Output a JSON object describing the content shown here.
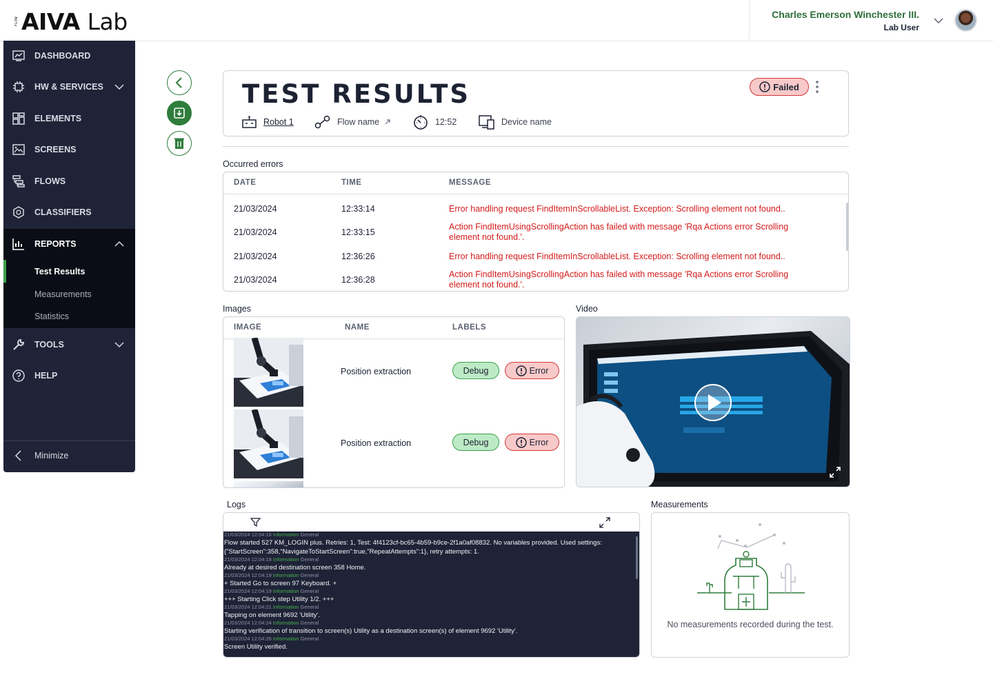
{
  "app": {
    "logo_small": "FLOW",
    "logo_main": "AIVA",
    "logo_lab": "Lab"
  },
  "user": {
    "name": "Charles Emerson Winchester III.",
    "role": "Lab User"
  },
  "sidebar": {
    "items": [
      {
        "label": "DASHBOARD",
        "icon": "dashboard-icon"
      },
      {
        "label": "HW & SERVICES",
        "icon": "chip-icon"
      },
      {
        "label": "ELEMENTS",
        "icon": "elements-icon"
      },
      {
        "label": "SCREENS",
        "icon": "screens-icon"
      },
      {
        "label": "FLOWS",
        "icon": "flows-icon"
      },
      {
        "label": "CLASSIFIERS",
        "icon": "classifiers-icon"
      },
      {
        "label": "REPORTS",
        "icon": "reports-icon"
      },
      {
        "label": "TOOLS",
        "icon": "wrench-icon"
      },
      {
        "label": "HELP",
        "icon": "help-icon"
      }
    ],
    "reports_sub": [
      "Test Results",
      "Measurements",
      "Statistics"
    ],
    "minimize": "Minimize"
  },
  "test": {
    "title": "TEST RESULTS",
    "status": "Failed",
    "robot": "Robot 1",
    "flow": "Flow name",
    "duration": "12:52",
    "device": "Device name"
  },
  "errors": {
    "label": "Occurred errors",
    "columns": [
      "DATE",
      "TIME",
      "MESSAGE"
    ],
    "rows": [
      {
        "date": "21/03/2024",
        "time": "12:33:14",
        "message": "Error handling request FindItemInScrollableList. Exception: Scrolling element not found.."
      },
      {
        "date": "21/03/2024",
        "time": "12:33:15",
        "message": "Action FindItemUsingScrollingAction has failed with message 'Rqa Actions error Scrolling element not found.'."
      },
      {
        "date": "21/03/2024",
        "time": "12:36:26",
        "message": "Error handling request FindItemInScrollableList. Exception: Scrolling element not found.."
      },
      {
        "date": "21/03/2024",
        "time": "12:36:28",
        "message": "Action FindItemUsingScrollingAction has failed with message 'Rqa Actions error Scrolling element not found.'."
      }
    ]
  },
  "images": {
    "label": "Images",
    "columns": [
      "IMAGE",
      "NAME",
      "LABELS"
    ],
    "rows": [
      {
        "name": "Position extraction",
        "tags": [
          "Debug",
          "Error"
        ]
      },
      {
        "name": "Position extraction",
        "tags": [
          "Debug",
          "Error"
        ]
      }
    ]
  },
  "video": {
    "label": "Video"
  },
  "logs": {
    "label": "Logs",
    "entries": [
      {
        "meta": "21/03/2024 12:04:16",
        "level": "Information",
        "category": "General",
        "text": "Flow started 527 KM_LOGIN plus. Retries: 1, Test: 4f4123cf-bc65-4b59-b9ce-2f1a0af08832. No variables provided. Used settings: {\"StartScreen\":358,\"NavigateToStartScreen\":true,\"RepeatAttempts\":1}, retry attempts: 1."
      },
      {
        "meta": "21/03/2024 12:04:18",
        "level": "Information",
        "category": "General",
        "text": "Already at desired destination screen 358 Home."
      },
      {
        "meta": "21/03/2024 12:04:19",
        "level": "Information",
        "category": "General",
        "text": "+ Started Go to screen 97 Keyboard. +"
      },
      {
        "meta": "21/03/2024 12:04:19",
        "level": "Information",
        "category": "General",
        "text": "+++ Starting Click step Utility 1/2. +++"
      },
      {
        "meta": "21/03/2024 12:04:21",
        "level": "Information",
        "category": "General",
        "text": "Tapping on element 9692 'Utility'."
      },
      {
        "meta": "21/03/2024 12:04:24",
        "level": "Information",
        "category": "General",
        "text": "Starting verification of transition to screen(s) Utility as a destination screen(s) of element 9692 'Utility'."
      },
      {
        "meta": "21/03/2024 12:04:26",
        "level": "Information",
        "category": "General",
        "text": "Screen Utility verified."
      }
    ]
  },
  "measurements": {
    "label": "Measurements",
    "empty_text": "No measurements recorded during the test."
  },
  "colors": {
    "sidebar_bg": "#1f2337",
    "accent_green": "#2f7d3c",
    "error_red": "#d41b1b",
    "failed_pill_bg": "#f8c9c9",
    "debug_pill_bg": "#bdebc6"
  }
}
